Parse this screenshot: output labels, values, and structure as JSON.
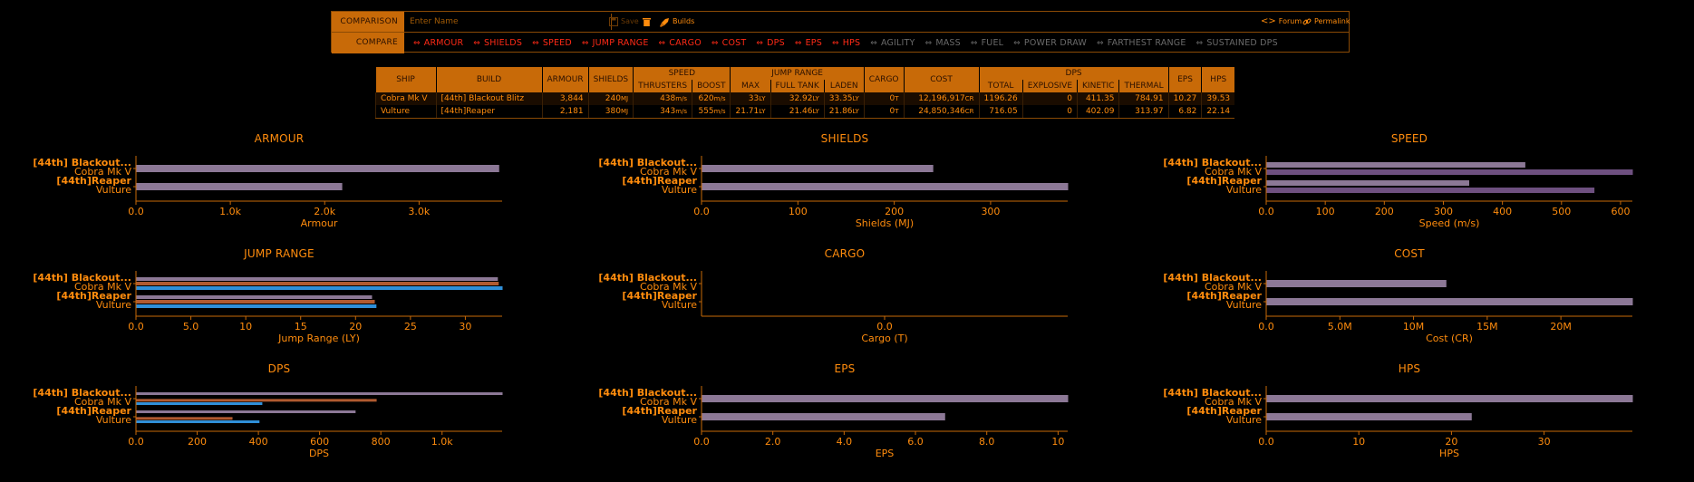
{
  "topbar": {
    "comparison_label": "COMPARISON",
    "name_placeholder": "Enter Name",
    "save_label": "Save",
    "builds_label": "Builds",
    "forum_label": "Forum",
    "permalink_label": "Permalink",
    "compare_label": "COMPARE",
    "compare_items": [
      {
        "label": "ARMOUR",
        "active": true
      },
      {
        "label": "SHIELDS",
        "active": true
      },
      {
        "label": "SPEED",
        "active": true
      },
      {
        "label": "JUMP RANGE",
        "active": true
      },
      {
        "label": "CARGO",
        "active": true
      },
      {
        "label": "COST",
        "active": true
      },
      {
        "label": "DPS",
        "active": true
      },
      {
        "label": "EPS",
        "active": true
      },
      {
        "label": "HPS",
        "active": true
      },
      {
        "label": "AGILITY",
        "active": false
      },
      {
        "label": "MASS",
        "active": false
      },
      {
        "label": "FUEL",
        "active": false
      },
      {
        "label": "POWER DRAW",
        "active": false
      },
      {
        "label": "FARTHEST RANGE",
        "active": false
      },
      {
        "label": "SUSTAINED DPS",
        "active": false
      }
    ]
  },
  "table": {
    "headers": {
      "ship": "SHIP",
      "build": "BUILD",
      "armour": "ARMOUR",
      "shields": "SHIELDS",
      "speed": "SPEED",
      "thrusters": "THRUSTERS",
      "boost": "BOOST",
      "jump_range": "JUMP RANGE",
      "max": "MAX",
      "full_tank": "FULL TANK",
      "laden": "LADEN",
      "cargo": "CARGO",
      "cost": "COST",
      "dps": "DPS",
      "total": "TOTAL",
      "explosive": "EXPLOSIVE",
      "kinetic": "KINETIC",
      "thermal": "THERMAL",
      "eps": "EPS",
      "hps": "HPS"
    },
    "rows": [
      {
        "ship": "Cobra Mk V",
        "build": "[44th] Blackout Blitz",
        "armour": "3,844",
        "shields": "240",
        "shields_u": "MJ",
        "thrusters": "438",
        "thrusters_u": "m/s",
        "boost": "620",
        "boost_u": "m/s",
        "max": "33",
        "max_u": "LY",
        "full_tank": "32.92",
        "full_tank_u": "LY",
        "laden": "33.35",
        "laden_u": "LY",
        "cargo": "0",
        "cargo_u": "T",
        "cost": "12,196,917",
        "cost_u": "CR",
        "total": "1196.26",
        "explosive": "0",
        "kinetic": "411.35",
        "thermal": "784.91",
        "eps": "10.27",
        "hps": "39.53"
      },
      {
        "ship": "Vulture",
        "build": "[44th]Reaper",
        "armour": "2,181",
        "shields": "380",
        "shields_u": "MJ",
        "thrusters": "343",
        "thrusters_u": "m/s",
        "boost": "555",
        "boost_u": "m/s",
        "max": "21.71",
        "max_u": "LY",
        "full_tank": "21.46",
        "full_tank_u": "LY",
        "laden": "21.86",
        "laden_u": "LY",
        "cargo": "0",
        "cargo_u": "T",
        "cost": "24,850,346",
        "cost_u": "CR",
        "total": "716.05",
        "explosive": "0",
        "kinetic": "402.09",
        "thermal": "313.97",
        "eps": "6.82",
        "hps": "22.14"
      }
    ]
  },
  "chart_data": [
    {
      "type": "bar",
      "title": "ARMOUR",
      "xlabel": "Armour",
      "categories": [
        [
          "[44th] Blackout...",
          "Cobra Mk V"
        ],
        [
          "[44th]Reaper",
          "Vulture"
        ]
      ],
      "series": [
        {
          "values": [
            3844,
            2181
          ],
          "color": "#8c7896"
        }
      ],
      "xmax": 3880,
      "ticks": [
        0,
        1000,
        2000,
        3000
      ],
      "tick_labels": [
        "0.0",
        "1.0k",
        "2.0k",
        "3.0k"
      ]
    },
    {
      "type": "bar",
      "title": "SHIELDS",
      "xlabel": "Shields (MJ)",
      "categories": [
        [
          "[44th] Blackout...",
          "Cobra Mk V"
        ],
        [
          "[44th]Reaper",
          "Vulture"
        ]
      ],
      "series": [
        {
          "values": [
            240,
            380
          ],
          "color": "#8c7896"
        }
      ],
      "xmax": 380,
      "ticks": [
        0,
        100,
        200,
        300
      ],
      "tick_labels": [
        "0.0",
        "100",
        "200",
        "300"
      ]
    },
    {
      "type": "bar",
      "title": "SPEED",
      "xlabel": "Speed (m/s)",
      "categories": [
        [
          "[44th] Blackout...",
          "Cobra Mk V"
        ],
        [
          "[44th]Reaper",
          "Vulture"
        ]
      ],
      "series": [
        {
          "values": [
            438,
            343
          ],
          "color": "#8c7896"
        },
        {
          "values": [
            620,
            555
          ],
          "color": "#6e5080"
        }
      ],
      "xmax": 620,
      "ticks": [
        0,
        100,
        200,
        300,
        400,
        500,
        600
      ],
      "tick_labels": [
        "0.0",
        "100",
        "200",
        "300",
        "400",
        "500",
        "600"
      ]
    },
    {
      "type": "bar",
      "title": "JUMP RANGE",
      "xlabel": "Jump Range (LY)",
      "categories": [
        [
          "[44th] Blackout...",
          "Cobra Mk V"
        ],
        [
          "[44th]Reaper",
          "Vulture"
        ]
      ],
      "series": [
        {
          "values": [
            32.92,
            21.46
          ],
          "color": "#8c7896"
        },
        {
          "values": [
            33,
            21.71
          ],
          "color": "#b05a30"
        },
        {
          "values": [
            33.35,
            21.86
          ],
          "color": "#2f8fd8"
        }
      ],
      "xmax": 33.35,
      "ticks": [
        0,
        5,
        10,
        15,
        20,
        25,
        30
      ],
      "tick_labels": [
        "0.0",
        "5.0",
        "10",
        "15",
        "20",
        "25",
        "30"
      ]
    },
    {
      "type": "bar",
      "title": "CARGO",
      "xlabel": "Cargo (T)",
      "categories": [
        [
          "[44th] Blackout...",
          "Cobra Mk V"
        ],
        [
          "[44th]Reaper",
          "Vulture"
        ]
      ],
      "series": [
        {
          "values": [
            0,
            0
          ],
          "color": "#8c7896"
        }
      ],
      "xmax": 1,
      "ticks": [
        0.5
      ],
      "tick_labels": [
        "0.0"
      ]
    },
    {
      "type": "bar",
      "title": "COST",
      "xlabel": "Cost (CR)",
      "categories": [
        [
          "[44th] Blackout...",
          "Cobra Mk V"
        ],
        [
          "[44th]Reaper",
          "Vulture"
        ]
      ],
      "series": [
        {
          "values": [
            12196917,
            24850346
          ],
          "color": "#8c7896"
        }
      ],
      "xmax": 24850346,
      "ticks": [
        0,
        5000000,
        10000000,
        15000000,
        20000000
      ],
      "tick_labels": [
        "0.0",
        "5.0M",
        "10M",
        "15M",
        "20M"
      ]
    },
    {
      "type": "bar",
      "title": "DPS",
      "xlabel": "DPS",
      "categories": [
        [
          "[44th] Blackout...",
          "Cobra Mk V"
        ],
        [
          "[44th]Reaper",
          "Vulture"
        ]
      ],
      "series": [
        {
          "values": [
            1196.26,
            716.05
          ],
          "color": "#8c7896"
        },
        {
          "values": [
            0,
            0
          ],
          "color": "#5a5a5a"
        },
        {
          "values": [
            784.91,
            313.97
          ],
          "color": "#b05a30"
        },
        {
          "values": [
            411.35,
            402.09
          ],
          "color": "#2f8fd8"
        }
      ],
      "xmax": 1196.26,
      "ticks": [
        0,
        200,
        400,
        600,
        800,
        1000
      ],
      "tick_labels": [
        "0.0",
        "200",
        "400",
        "600",
        "800",
        "1.0k"
      ]
    },
    {
      "type": "bar",
      "title": "EPS",
      "xlabel": "EPS",
      "categories": [
        [
          "[44th] Blackout...",
          "Cobra Mk V"
        ],
        [
          "[44th]Reaper",
          "Vulture"
        ]
      ],
      "series": [
        {
          "values": [
            10.27,
            6.82
          ],
          "color": "#8c7896"
        }
      ],
      "xmax": 10.27,
      "ticks": [
        0,
        2,
        4,
        6,
        8,
        10
      ],
      "tick_labels": [
        "0.0",
        "2.0",
        "4.0",
        "6.0",
        "8.0",
        "10"
      ]
    },
    {
      "type": "bar",
      "title": "HPS",
      "xlabel": "HPS",
      "categories": [
        [
          "[44th] Blackout...",
          "Cobra Mk V"
        ],
        [
          "[44th]Reaper",
          "Vulture"
        ]
      ],
      "series": [
        {
          "values": [
            39.53,
            22.14
          ],
          "color": "#8c7896"
        }
      ],
      "xmax": 39.53,
      "ticks": [
        0,
        10,
        20,
        30
      ],
      "tick_labels": [
        "0.0",
        "10",
        "20",
        "30"
      ]
    }
  ]
}
